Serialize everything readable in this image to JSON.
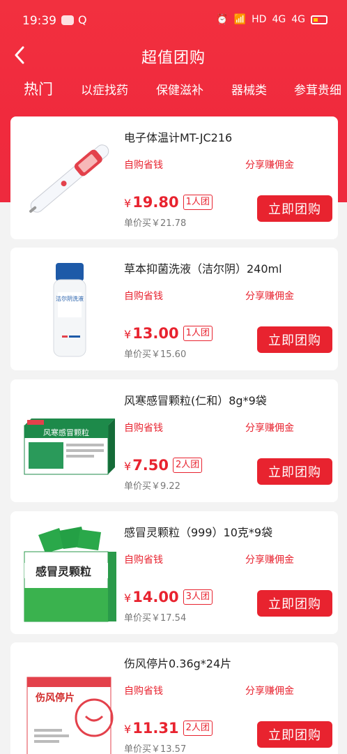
{
  "status": {
    "time": "19:39",
    "q": "Q",
    "net": "HD",
    "sig1": "4G",
    "sig2": "4G"
  },
  "nav": {
    "title": "超值团购"
  },
  "tabs": [
    {
      "label": "热门",
      "active": true
    },
    {
      "label": "以症找药"
    },
    {
      "label": "保健滋补"
    },
    {
      "label": "器械类"
    },
    {
      "label": "参茸贵细"
    }
  ],
  "colors": {
    "brand": "#e8232f",
    "header": "#f02a3d"
  },
  "products": [
    {
      "title": "电子体温计MT-JC216",
      "tag_self": "自购省钱",
      "tag_share": "分享赚佣金",
      "yen": "¥",
      "price": "19.80",
      "group": "1人团",
      "unit_price": "单价买￥21.78",
      "button": "立即团购",
      "image_icon": "thermometer-image"
    },
    {
      "title": "草本抑菌洗液（洁尔阴）240ml",
      "tag_self": "自购省钱",
      "tag_share": "分享赚佣金",
      "yen": "¥",
      "price": "13.00",
      "group": "1人团",
      "unit_price": "单价买￥15.60",
      "button": "立即团购",
      "image_icon": "wash-bottle-image",
      "image_text": "洁尔阴洗液"
    },
    {
      "title": "风寒感冒颗粒(仁和）8g*9袋",
      "tag_self": "自购省钱",
      "tag_share": "分享赚佣金",
      "yen": "¥",
      "price": "7.50",
      "group": "2人团",
      "unit_price": "单价买￥9.22",
      "button": "立即团购",
      "image_icon": "medicine-box-image",
      "image_text": "风寒感冒颗粒"
    },
    {
      "title": "感冒灵颗粒（999）10克*9袋",
      "tag_self": "自购省钱",
      "tag_share": "分享赚佣金",
      "yen": "¥",
      "price": "14.00",
      "group": "3人团",
      "unit_price": "单价买￥17.54",
      "button": "立即团购",
      "image_icon": "medicine-box-image",
      "image_text": "感冒灵颗粒"
    },
    {
      "title": "伤风停片0.36g*24片",
      "tag_self": "自购省钱",
      "tag_share": "分享赚佣金",
      "yen": "¥",
      "price": "11.31",
      "group": "2人团",
      "unit_price": "单价买￥13.57",
      "button": "立即团购",
      "image_icon": "medicine-box-image",
      "image_text": "伤风停片"
    }
  ]
}
